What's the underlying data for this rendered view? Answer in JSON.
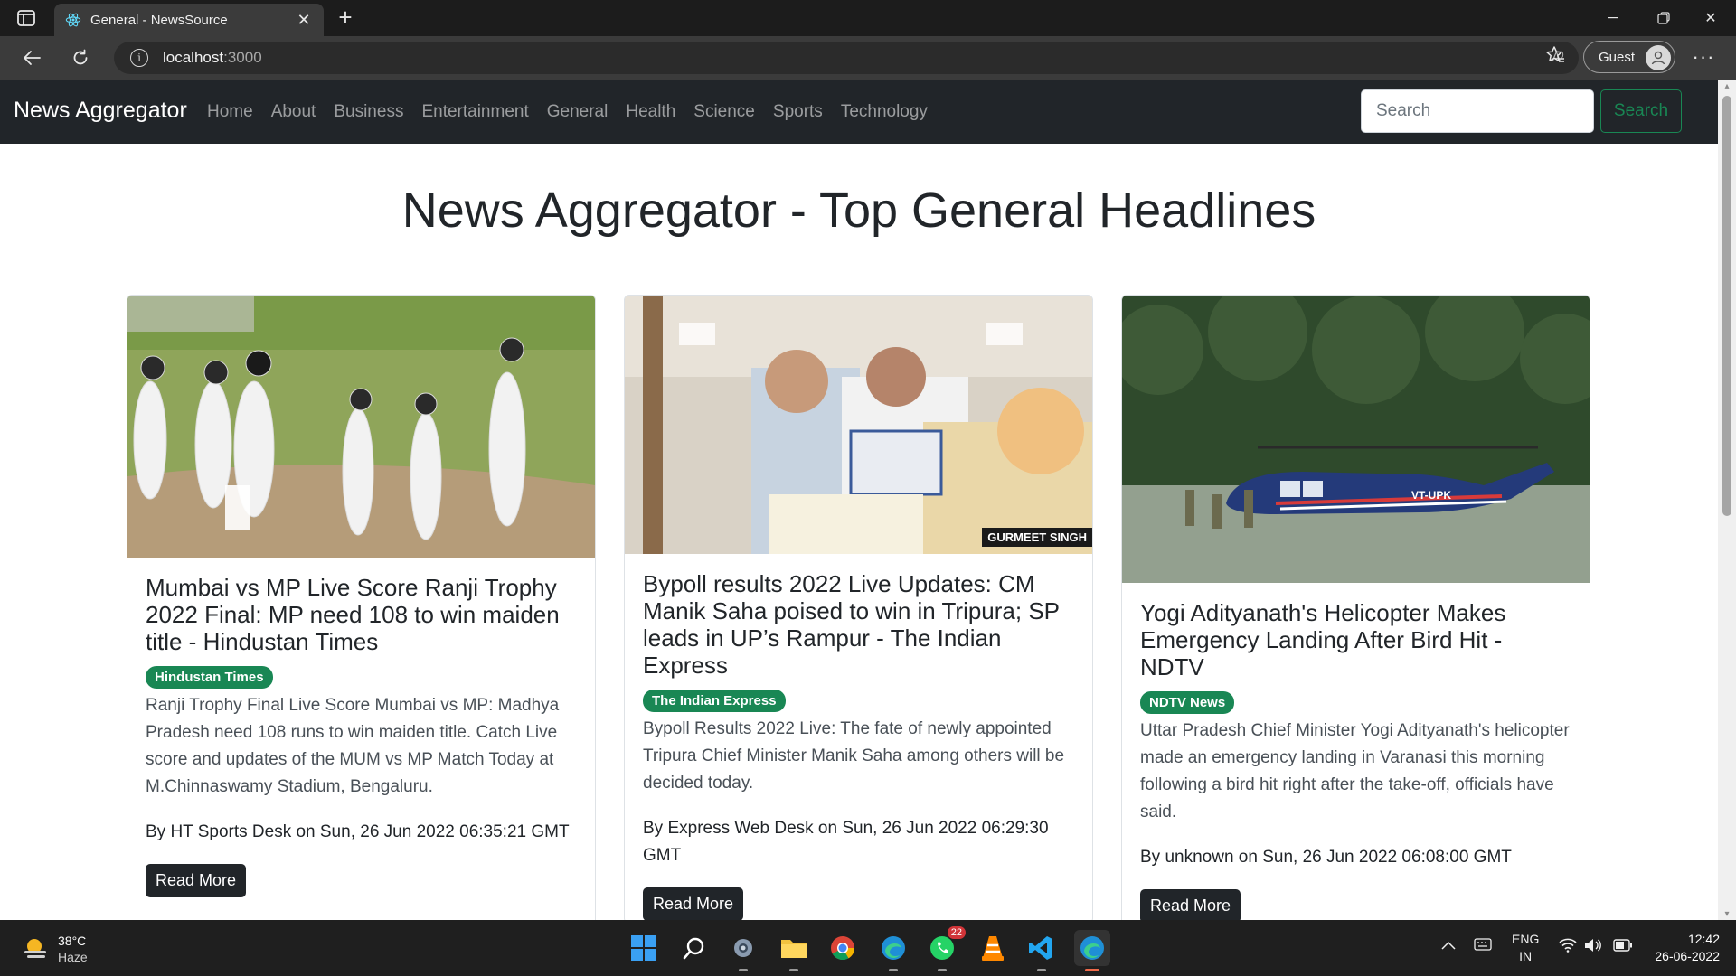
{
  "browser": {
    "tab_title": "General - NewsSource",
    "url_host": "localhost",
    "url_port": ":3000",
    "profile_label": "Guest",
    "read_aloud_glyph": "A⁾"
  },
  "site": {
    "brand": "News Aggregator",
    "nav_links": [
      "Home",
      "About",
      "Business",
      "Entertainment",
      "General",
      "Health",
      "Science",
      "Sports",
      "Technology"
    ],
    "search_placeholder": "Search",
    "search_button": "Search",
    "page_title": "News Aggregator - Top General Headlines"
  },
  "articles": [
    {
      "title": "Mumbai vs MP Live Score Ranji Trophy 2022 Final: MP need 108 to win maiden title - Hindustan Times",
      "source": "Hindustan Times",
      "description": "Ranji Trophy Final Live Score Mumbai vs MP: Madhya Pradesh need 108 runs to win maiden title. Catch Live score and updates of the MUM vs MP Match Today at M.Chinnaswamy Stadium, Bengaluru.",
      "meta": "By HT Sports Desk on Sun, 26 Jun 2022 06:35:21 GMT",
      "button": "Read More"
    },
    {
      "title": "Bypoll results 2022 Live Updates: CM Manik Saha poised to win in Tripura; SP leads in UP’s Rampur - The Indian Express",
      "source": "The Indian Express",
      "description": "Bypoll Results 2022 Live: The fate of newly appointed Tripura Chief Minister Manik Saha among others will be decided today.",
      "meta": "By Express Web Desk on Sun, 26 Jun 2022 06:29:30 GMT",
      "button": "Read More",
      "image_credit": "GURMEET SINGH"
    },
    {
      "title": "Yogi Adityanath's Helicopter Makes Emergency Landing After Bird Hit - NDTV",
      "source": "NDTV News",
      "description": "Uttar Pradesh Chief Minister Yogi Adityanath's helicopter made an emergency landing in Varanasi this morning following a bird hit right after the take-off, officials have said.",
      "meta": "By unknown on Sun, 26 Jun 2022 06:08:00 GMT",
      "button": "Read More",
      "image_text": "VT-UPK"
    }
  ],
  "taskbar": {
    "temperature": "38°C",
    "weather": "Haze",
    "whatsapp_badge": "22",
    "lang_1": "ENG",
    "lang_2": "IN",
    "time": "12:42",
    "date": "26-06-2022"
  }
}
